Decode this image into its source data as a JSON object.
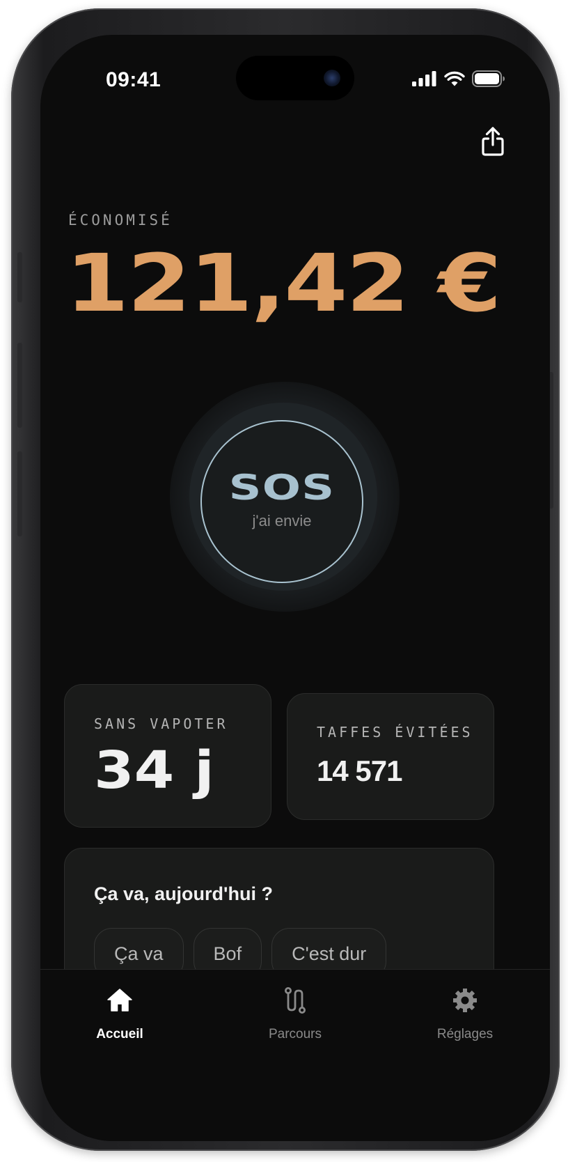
{
  "status_bar": {
    "time": "09:41"
  },
  "header": {
    "share_icon": "share-icon"
  },
  "savings": {
    "label": "ÉCONOMISÉ",
    "amount": "121,42 €",
    "accent_color": "#dfa066"
  },
  "sos": {
    "title": "SOS",
    "subtitle": "j'ai envie",
    "accent_color": "#a7c1cf"
  },
  "stats": {
    "days_label": "SANS VAPOTER",
    "days_value": "34 j",
    "puffs_label": "TAFFES ÉVITÉES",
    "puffs_value": "14 571"
  },
  "mood": {
    "question": "Ça va, aujourd'hui ?",
    "options": [
      "Ça va",
      "Bof",
      "C'est dur"
    ]
  },
  "tabs": [
    {
      "label": "Accueil",
      "icon": "home-icon",
      "active": true
    },
    {
      "label": "Parcours",
      "icon": "route-icon",
      "active": false
    },
    {
      "label": "Réglages",
      "icon": "gear-icon",
      "active": false
    }
  ]
}
